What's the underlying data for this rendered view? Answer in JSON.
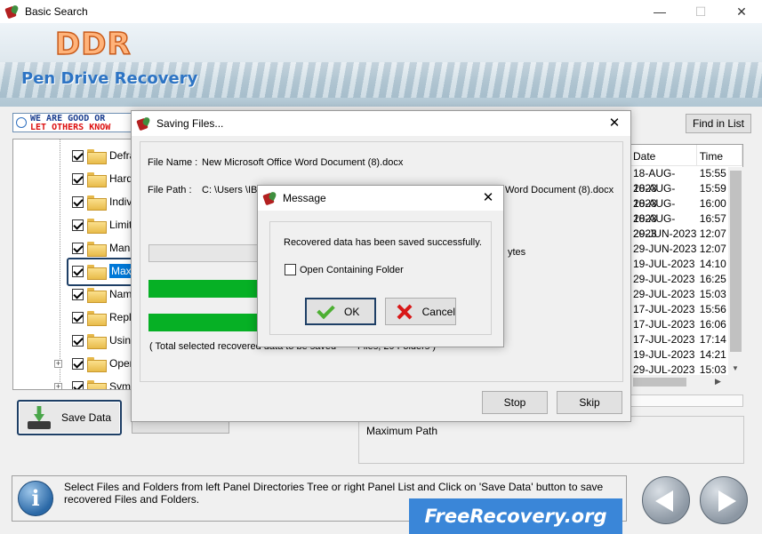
{
  "window": {
    "title": "Basic Search",
    "minimize": "—",
    "maximize": "☐",
    "close": "✕"
  },
  "banner": {
    "logo": "DDR",
    "product": "Pen Drive Recovery"
  },
  "good_banner": {
    "line1": "WE ARE GOOD OR",
    "line2": "LET OTHERS KNOW"
  },
  "find_button": "Find in List",
  "tree": {
    "items": [
      {
        "label": "Defragment",
        "selected": false
      },
      {
        "label": "Hardware",
        "selected": false
      },
      {
        "label": "Individual",
        "selected": false
      },
      {
        "label": "Limitations",
        "selected": false
      },
      {
        "label": "Manage",
        "selected": false
      },
      {
        "label": "Maximum Path",
        "selected": true
      },
      {
        "label": "Name",
        "selected": false
      },
      {
        "label": "Replace",
        "selected": false
      },
      {
        "label": "Using",
        "selected": false
      },
      {
        "label": "Open",
        "selected": false
      },
      {
        "label": "Symbols",
        "selected": false
      }
    ]
  },
  "list": {
    "headers": {
      "date": "Date",
      "time": "Time"
    },
    "rows": [
      {
        "date": "18-AUG-2023",
        "time": "15:55"
      },
      {
        "date": "18-AUG-2023",
        "time": "15:59"
      },
      {
        "date": "18-AUG-2023",
        "time": "16:00"
      },
      {
        "date": "18-AUG-2023",
        "time": "16:57"
      },
      {
        "date": "29-JUN-2023",
        "time": "12:07"
      },
      {
        "date": "29-JUN-2023",
        "time": "12:07"
      },
      {
        "date": "19-JUL-2023",
        "time": "14:10"
      },
      {
        "date": "29-JUL-2023",
        "time": "16:25"
      },
      {
        "date": "29-JUL-2023",
        "time": "15:03"
      },
      {
        "date": "17-JUL-2023",
        "time": "15:56"
      },
      {
        "date": "17-JUL-2023",
        "time": "16:06"
      },
      {
        "date": "17-JUL-2023",
        "time": "17:14"
      },
      {
        "date": "19-JUL-2023",
        "time": "14:21"
      },
      {
        "date": "29-JUL-2023",
        "time": "15:03"
      }
    ]
  },
  "info_panel": {
    "text": "Maximum Path"
  },
  "save_data_button": "Save Data",
  "status": {
    "text": "Select Files and Folders from left Panel Directories Tree or right Panel List and Click on 'Save Data' button to save recovered Files and Folders."
  },
  "watermark": "FreeRecovery.org",
  "saving_dialog": {
    "title": "Saving Files...",
    "file_name_label": "File Name :",
    "file_name": "New Microsoft Office Word Document (8).docx",
    "file_path_label": "File Path  :",
    "file_path_start": "C: \\Users \\IB",
    "file_path_end": "Word Document (8).docx",
    "bytes_suffix": "ytes",
    "total_text": "( Total selected recovered data to be saved",
    "total_suffix": "Files, 29 Folders )",
    "progress1": 0.6,
    "progress2": 0.6,
    "stop_button": "Stop",
    "skip_button": "Skip"
  },
  "message_dialog": {
    "title": "Message",
    "text": "Recovered data has been saved successfully.",
    "checkbox_label": "Open Containing Folder",
    "checkbox_checked": false,
    "ok_button": "OK",
    "cancel_button": "Cancel"
  }
}
